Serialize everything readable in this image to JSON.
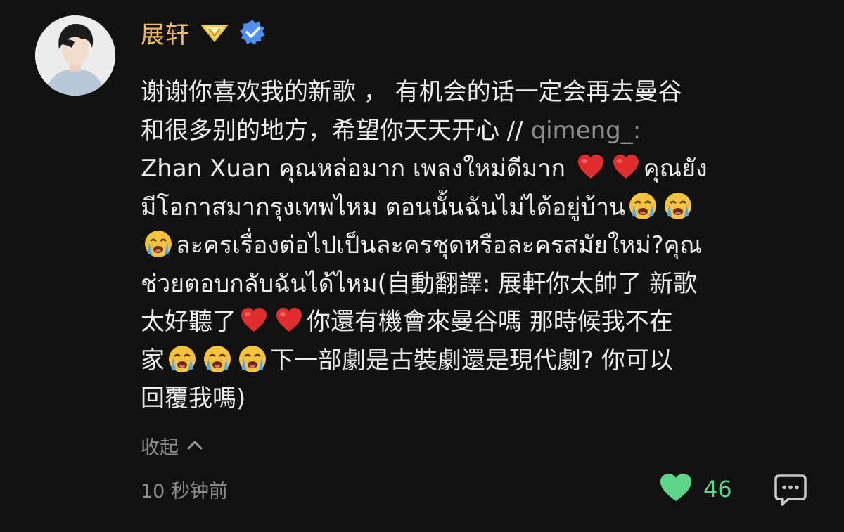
{
  "author": {
    "name": "展轩",
    "badge_icon": "gold-diamond-badge-icon",
    "verified_icon": "verified-check-icon",
    "name_color": "#f0bc63",
    "badge_color": "#f2c94c",
    "verified_color": "#4f8df0"
  },
  "comment": {
    "line1": "谢谢你喜欢我的新歌 ， 有机会的话一定会再去曼谷",
    "line2_text": "和很多别的地方，希望你天天开心 // ",
    "line2_mention": "qimeng_:",
    "line3_a": "Zhan Xuan คุณหล่อมาก เพลงใหม่ดีมาก ",
    "line3_b": "คุณยัง",
    "line4": "มีโอกาสมากรุงเทพไหม ตอนนั้นฉันไม่ได้อยู่บ้าน",
    "line5": "ละครเรื่องต่อไปเป็นละครชุดหรือละครสมัยใหม่?คุณ",
    "line6": "ช่วยตอบกลับฉันได้ไหม(自動翻譯: 展軒你太帥了 新歌",
    "line7_a": "太好聽了",
    "line7_b": "你還有機會來曼谷嗎 那時候我不在",
    "line8_a": "家",
    "line8_b": "下一部劇是古裝劇還是現代劇? 你可以",
    "line9": "回覆我嗎)",
    "emoji_icons": [
      "red-heart-icon",
      "loudly-crying-face-icon"
    ]
  },
  "actions": {
    "collapse_label": "收起",
    "collapse_icon": "chevron-up-icon",
    "timestamp": "10 秒钟前",
    "like_icon": "heart-icon",
    "like_count": "46",
    "like_color": "#5ed38a",
    "reply_icon": "chat-bubble-icon"
  },
  "colors": {
    "background": "#111111",
    "text": "#ededed",
    "muted": "#8d8d8d"
  }
}
